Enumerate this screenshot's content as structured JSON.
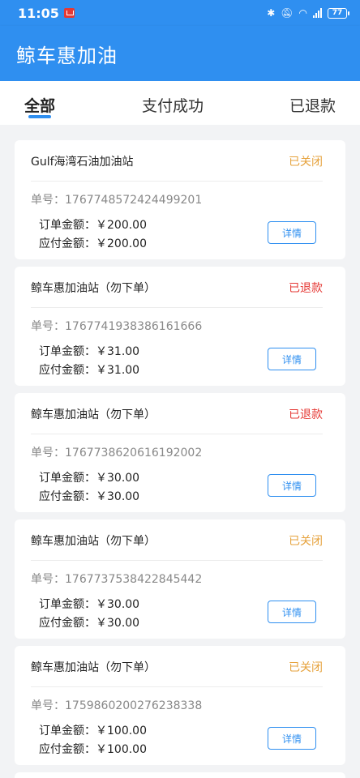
{
  "status_bar": {
    "time": "11:05",
    "battery": "77"
  },
  "app": {
    "title": "鲸车惠加油"
  },
  "tabs": [
    {
      "label": "全部"
    },
    {
      "label": "支付成功"
    },
    {
      "label": "已退款"
    }
  ],
  "labels": {
    "order_no": "单号：",
    "order_amount": "订单金额：",
    "payable_amount": "应付金额：",
    "detail_button": "详情"
  },
  "colors": {
    "accent": "#2f8ff0",
    "status_closed": "#e6a23c",
    "status_refunded": "#e53935"
  },
  "orders": [
    {
      "station": "Gulf海湾石油加油站",
      "status": "已关闭",
      "status_type": "closed",
      "order_no": "1767748572424499201",
      "order_amount": "￥200.00",
      "payable_amount": "￥200.00"
    },
    {
      "station": "鲸车惠加油站（勿下单）",
      "status": "已退款",
      "status_type": "refunded",
      "order_no": "1767741938386161666",
      "order_amount": "￥31.00",
      "payable_amount": "￥31.00"
    },
    {
      "station": "鲸车惠加油站（勿下单）",
      "status": "已退款",
      "status_type": "refunded",
      "order_no": "1767738620616192002",
      "order_amount": "￥30.00",
      "payable_amount": "￥30.00"
    },
    {
      "station": "鲸车惠加油站（勿下单）",
      "status": "已关闭",
      "status_type": "closed",
      "order_no": "1767737538422845442",
      "order_amount": "￥30.00",
      "payable_amount": "￥30.00"
    },
    {
      "station": "鲸车惠加油站（勿下单）",
      "status": "已关闭",
      "status_type": "closed",
      "order_no": "1759860200276238338",
      "order_amount": "￥100.00",
      "payable_amount": "￥100.00"
    }
  ]
}
